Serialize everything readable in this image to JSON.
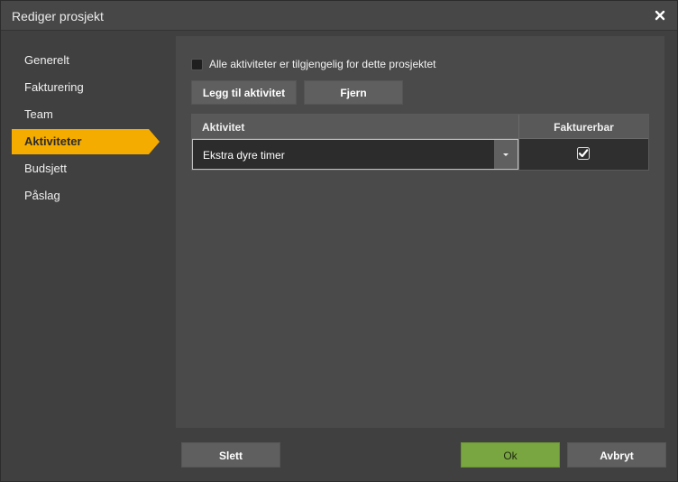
{
  "window": {
    "title": "Rediger prosjekt",
    "close_icon": "close-icon"
  },
  "sidebar": {
    "items": [
      {
        "label": "Generelt",
        "active": false
      },
      {
        "label": "Fakturering",
        "active": false
      },
      {
        "label": "Team",
        "active": false
      },
      {
        "label": "Aktiviteter",
        "active": true
      },
      {
        "label": "Budsjett",
        "active": false
      },
      {
        "label": "Påslag",
        "active": false
      }
    ]
  },
  "main": {
    "all_activities_checkbox": {
      "label": "Alle aktiviteter er tilgjengelig for dette prosjektet",
      "checked": false
    },
    "add_activity_label": "Legg til aktivitet",
    "remove_label": "Fjern",
    "grid": {
      "columns": [
        "Aktivitet",
        "Fakturerbar"
      ],
      "rows": [
        {
          "activity": "Ekstra dyre timer",
          "billable": true
        }
      ]
    }
  },
  "footer": {
    "delete_label": "Slett",
    "ok_label": "Ok",
    "cancel_label": "Avbryt"
  },
  "colors": {
    "accent": "#f5ac00",
    "ok": "#79a640",
    "background": "#404040"
  }
}
